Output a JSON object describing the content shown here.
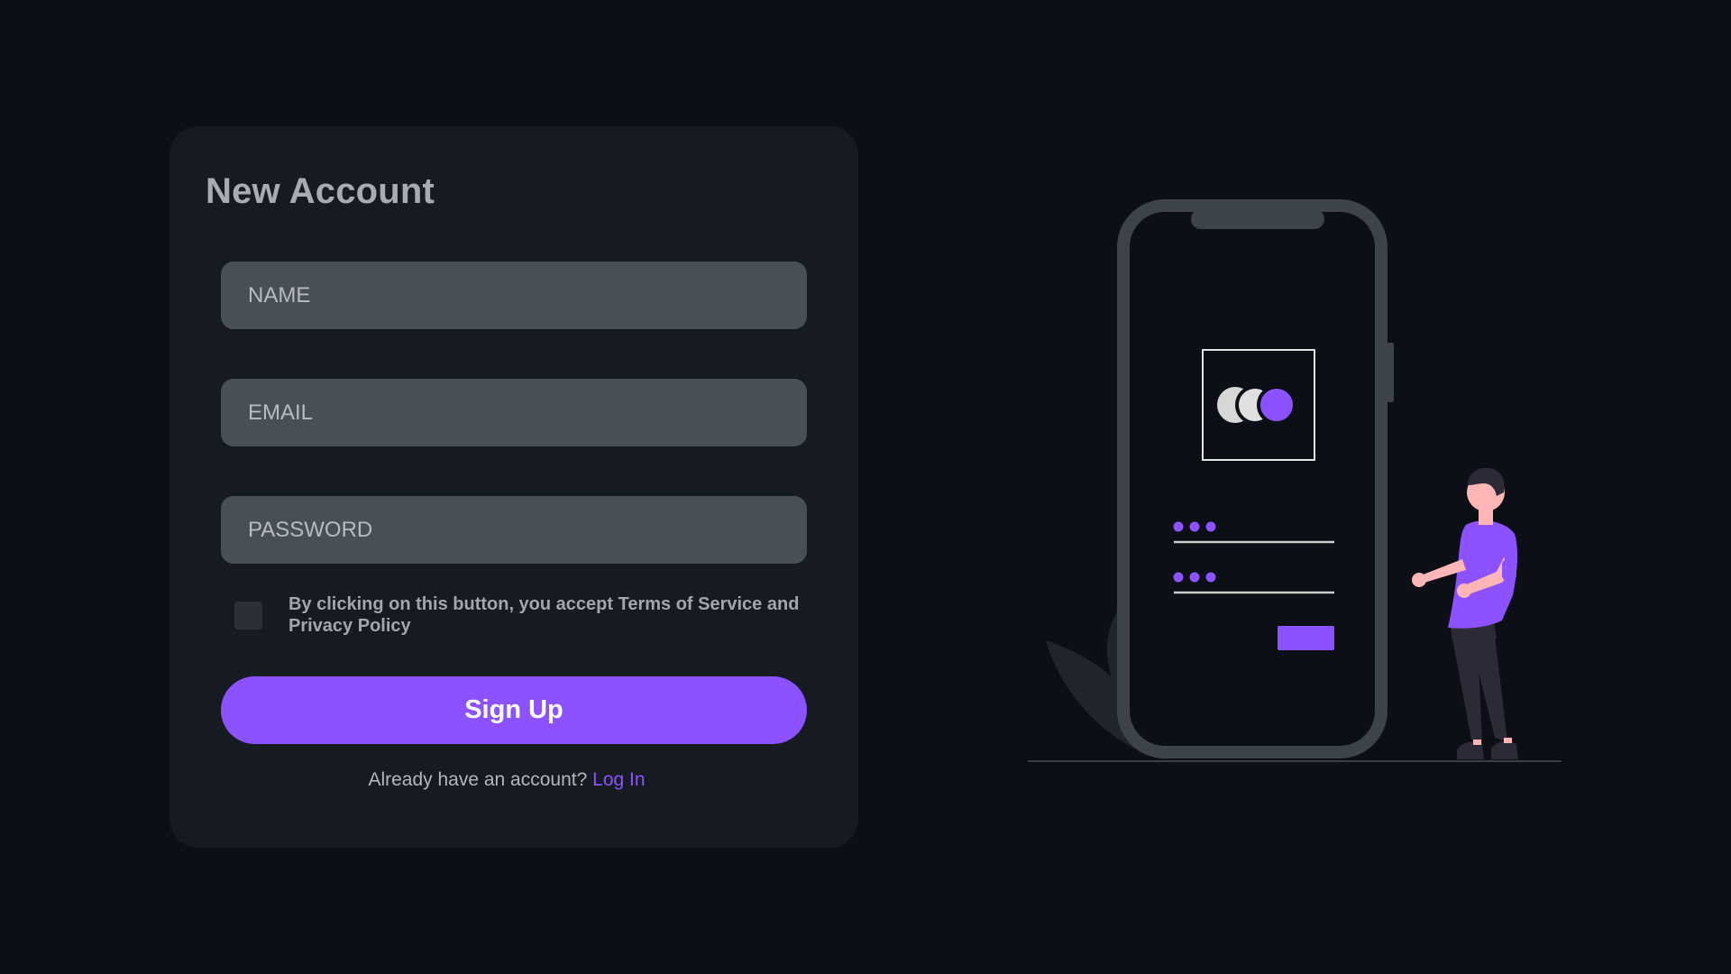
{
  "form": {
    "title": "New Account",
    "name_placeholder": "NAME",
    "email_placeholder": "EMAIL",
    "password_placeholder": "PASSWORD",
    "terms_text": "By clicking on this button, you accept Terms of Service and Privacy Policy",
    "signup_label": "Sign Up",
    "login_prompt": "Already have an account?",
    "login_link": "Log In"
  },
  "colors": {
    "background": "#0c0f16",
    "card": "#161a21",
    "field": "#484f57",
    "accent": "#8c52ff",
    "phone_frame": "#3d434b",
    "skin": "#ffb6b6"
  },
  "illustration": {
    "icon": "mobile-login-illustration"
  }
}
